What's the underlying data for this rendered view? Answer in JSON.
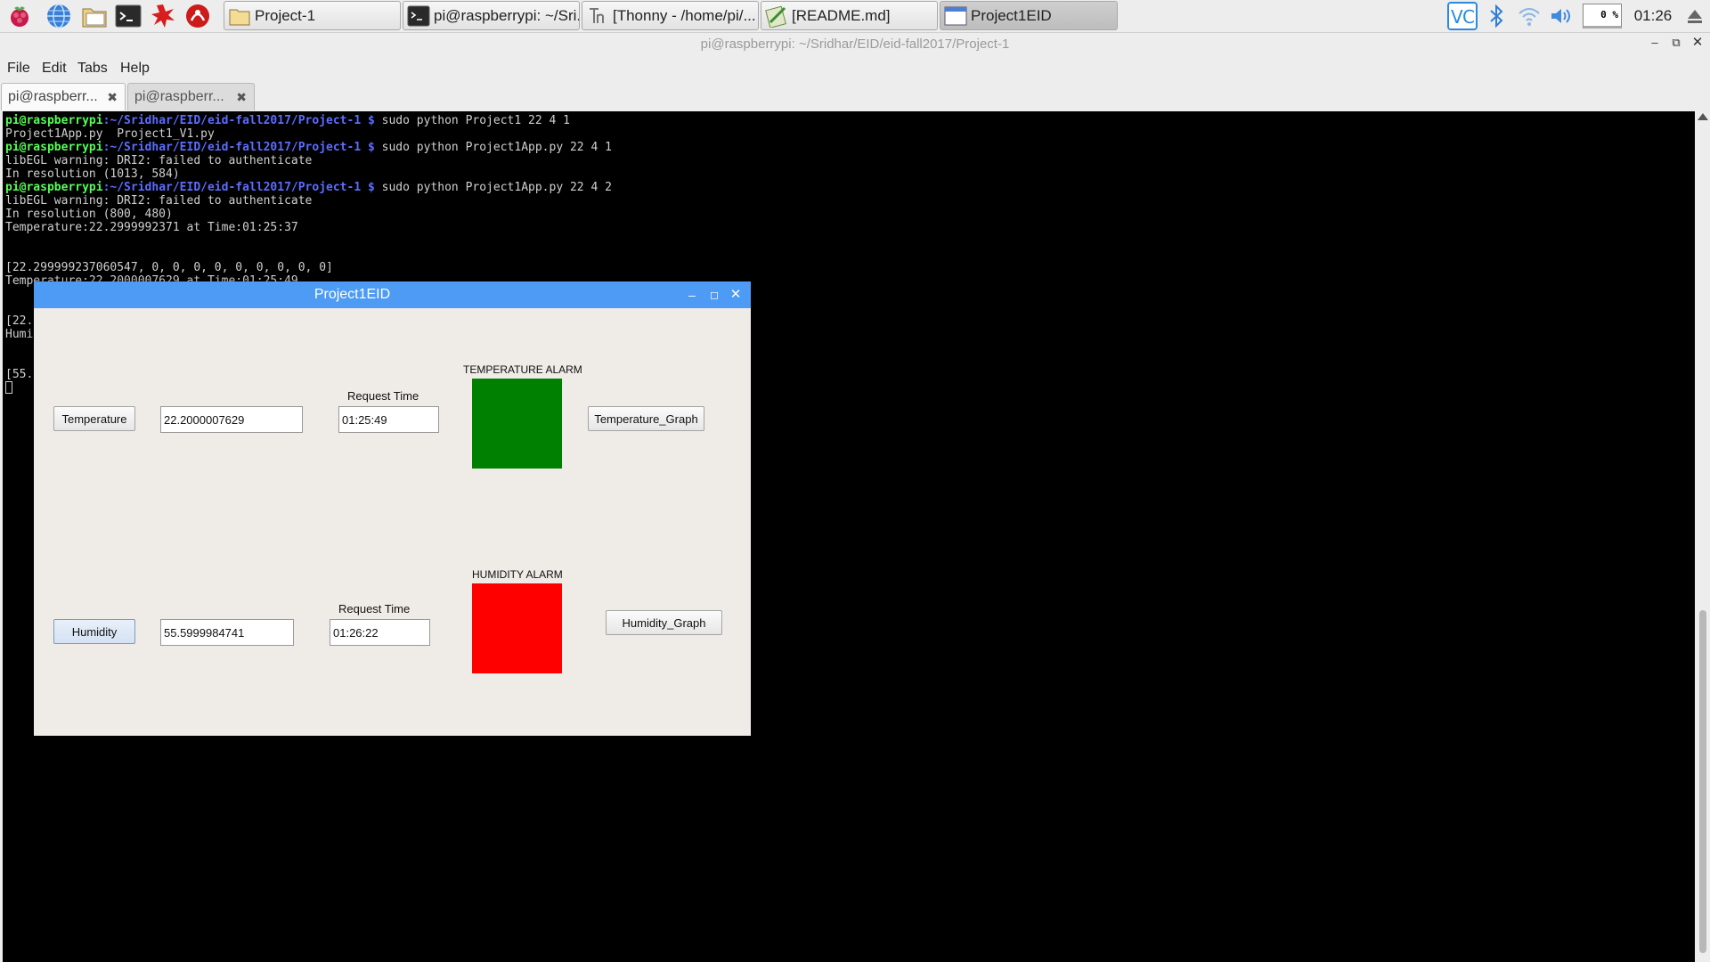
{
  "panel": {
    "launchers": [
      "raspberry-menu-icon",
      "web-browser-icon",
      "file-manager-icon",
      "terminal-icon",
      "wolfram-icon",
      "mathematica-icon"
    ],
    "tasks": [
      {
        "label": "Project-1",
        "icon": "folder-icon"
      },
      {
        "label": "pi@raspberrypi: ~/Sri...",
        "icon": "terminal-icon"
      },
      {
        "label": "[Thonny  -  /home/pi/...",
        "icon": "thonny-icon"
      },
      {
        "label": "[README.md]",
        "icon": "text-editor-icon"
      },
      {
        "label": "Project1EID",
        "icon": "window-icon"
      }
    ],
    "tray": {
      "cpu": "0 %",
      "clock": "01:26"
    }
  },
  "terminal": {
    "title": "pi@raspberrypi: ~/Sridhar/EID/eid-fall2017/Project-1",
    "menu": [
      "File",
      "Edit",
      "Tabs",
      "Help"
    ],
    "tabs": [
      "pi@raspberr...",
      "pi@raspberr..."
    ],
    "prompt_user": "pi@raspberrypi",
    "prompt_path": ":~/Sridhar/EID/eid-fall2017/Project-1 $",
    "lines": [
      {
        "type": "prompt",
        "cmd": " sudo python Project1 22 4 1"
      },
      {
        "type": "out",
        "text": "Project1App.py  Project1_V1.py"
      },
      {
        "type": "prompt",
        "cmd": " sudo python Project1App.py 22 4 1"
      },
      {
        "type": "out",
        "text": "libEGL warning: DRI2: failed to authenticate"
      },
      {
        "type": "out",
        "text": "In resolution (1013, 584)"
      },
      {
        "type": "prompt",
        "cmd": " sudo python Project1App.py 22 4 2"
      },
      {
        "type": "out",
        "text": "libEGL warning: DRI2: failed to authenticate"
      },
      {
        "type": "out",
        "text": "In resolution (800, 480)"
      },
      {
        "type": "out",
        "text": "Temperature:22.2999992371 at Time:01:25:37"
      },
      {
        "type": "out",
        "text": ""
      },
      {
        "type": "out",
        "text": ""
      },
      {
        "type": "out",
        "text": "[22.299999237060547, 0, 0, 0, 0, 0, 0, 0, 0, 0]"
      },
      {
        "type": "out",
        "text": "Temperature:22.2000007629 at Time:01:25:49"
      },
      {
        "type": "out",
        "text": ""
      },
      {
        "type": "out",
        "text": ""
      },
      {
        "type": "out",
        "text": "[22."
      },
      {
        "type": "out",
        "text": "Humi"
      },
      {
        "type": "out",
        "text": ""
      },
      {
        "type": "out",
        "text": ""
      },
      {
        "type": "out",
        "text": "[55."
      }
    ]
  },
  "app": {
    "title": "Project1EID",
    "temperature": {
      "button": "Temperature",
      "value": "22.2000007629",
      "request_label": "Request Time",
      "request_time": "01:25:49",
      "alarm_label": "TEMPERATURE ALARM",
      "alarm_color": "#008000",
      "graph_button": "Temperature_Graph"
    },
    "humidity": {
      "button": "Humidity",
      "value": "55.5999984741",
      "request_label": "Request Time",
      "request_time": "01:26:22",
      "alarm_label": "HUMIDITY ALARM",
      "alarm_color": "#ff0000",
      "graph_button": "Humidity_Graph"
    }
  }
}
